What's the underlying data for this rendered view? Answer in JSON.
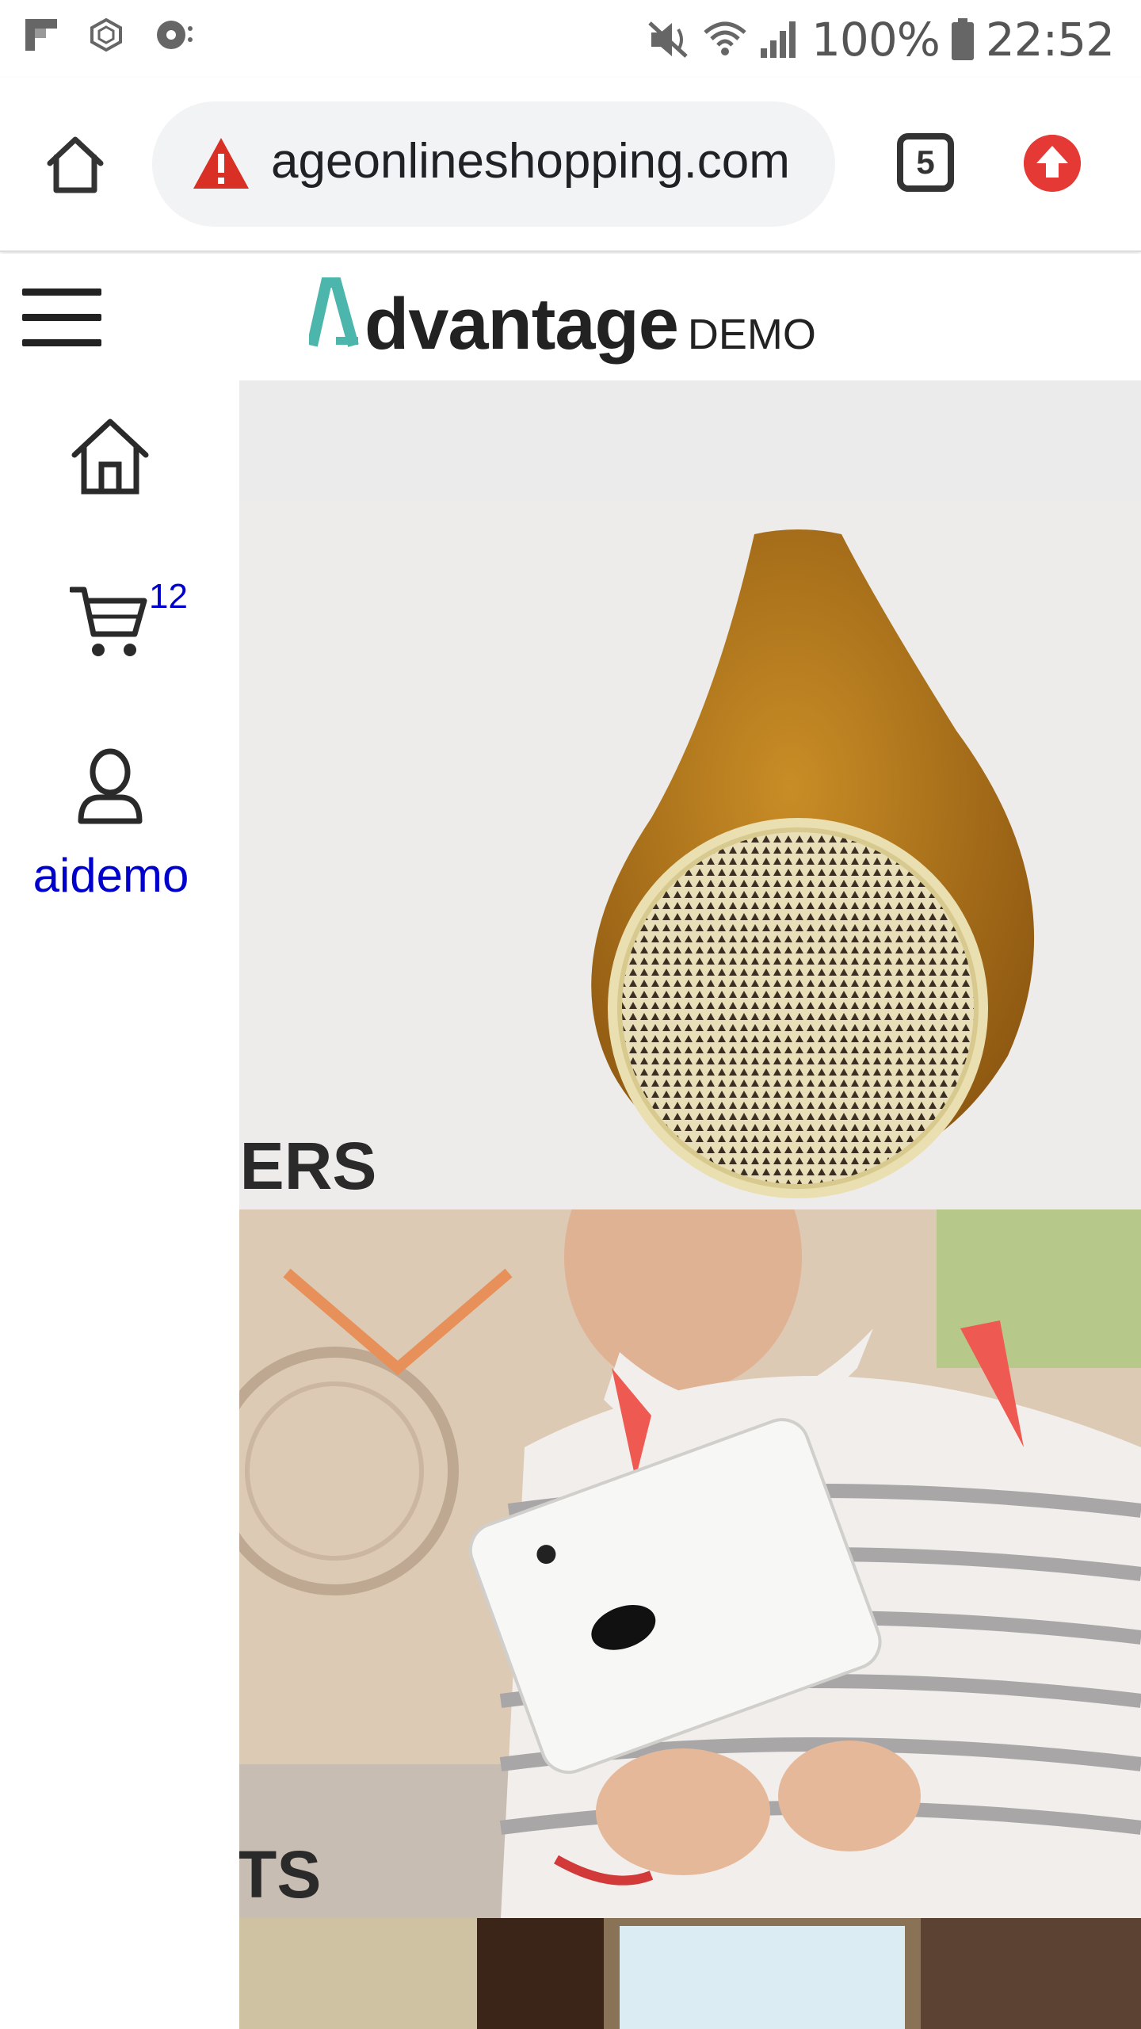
{
  "status_bar": {
    "battery": "100%",
    "time": "22:52",
    "icons": [
      "flipboard-icon",
      "app-icon",
      "podcast-icon",
      "mute-icon",
      "wifi-icon",
      "signal-icon",
      "battery-icon"
    ]
  },
  "browser": {
    "url": "ageonlineshopping.com",
    "tab_count": "5",
    "icons": [
      "home-icon",
      "warning-icon",
      "tab-switcher-icon",
      "update-icon"
    ]
  },
  "site": {
    "logo_name": "dvantage",
    "logo_demo": "DEMO",
    "accent_color": "#4db6ac"
  },
  "side_menu": {
    "cart_count": "12",
    "user_name": "aidemo"
  },
  "categories": [
    {
      "label": "KERS"
    },
    {
      "label": "ETS"
    }
  ]
}
